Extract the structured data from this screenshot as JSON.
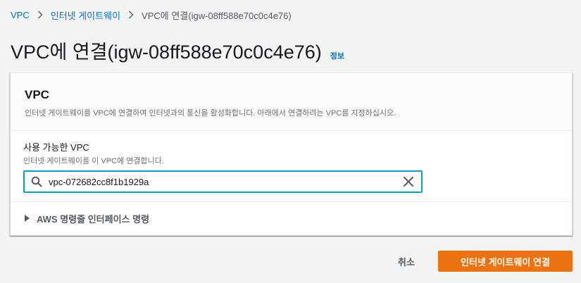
{
  "breadcrumb": {
    "items": [
      {
        "label": "VPC"
      },
      {
        "label": "인터넷 게이트웨이"
      },
      {
        "label": "VPC에 연결(igw-08ff588e70c0c4e76)"
      }
    ]
  },
  "page": {
    "title": "VPC에 연결(igw-08ff588e70c0c4e76)",
    "info_link": "정보"
  },
  "panel": {
    "title": "VPC",
    "description": "인터넷 게이트웨이를 VPC에 연결하여 인터넷과의 통신을 활성화합니다. 아래에서 연결하려는 VPC를 지정하십시오.",
    "field": {
      "label": "사용 가능한 VPC",
      "description": "인터넷 게이트웨이를 이 VPC에 연결합니다.",
      "value": "vpc-072682cc8f1b1929a"
    },
    "expander_label": "AWS 명령줄 인터페이스 명령"
  },
  "actions": {
    "cancel_label": "취소",
    "submit_label": "인터넷 게이트웨이 연결"
  },
  "colors": {
    "link": "#0073bb",
    "primary_button": "#ec7211",
    "focus_border": "#00a1c9",
    "background": "#f2f3f3"
  },
  "icons": {
    "separator": "chevron-right-icon",
    "search": "search-icon",
    "clear": "close-icon",
    "expander": "caret-right-icon"
  }
}
